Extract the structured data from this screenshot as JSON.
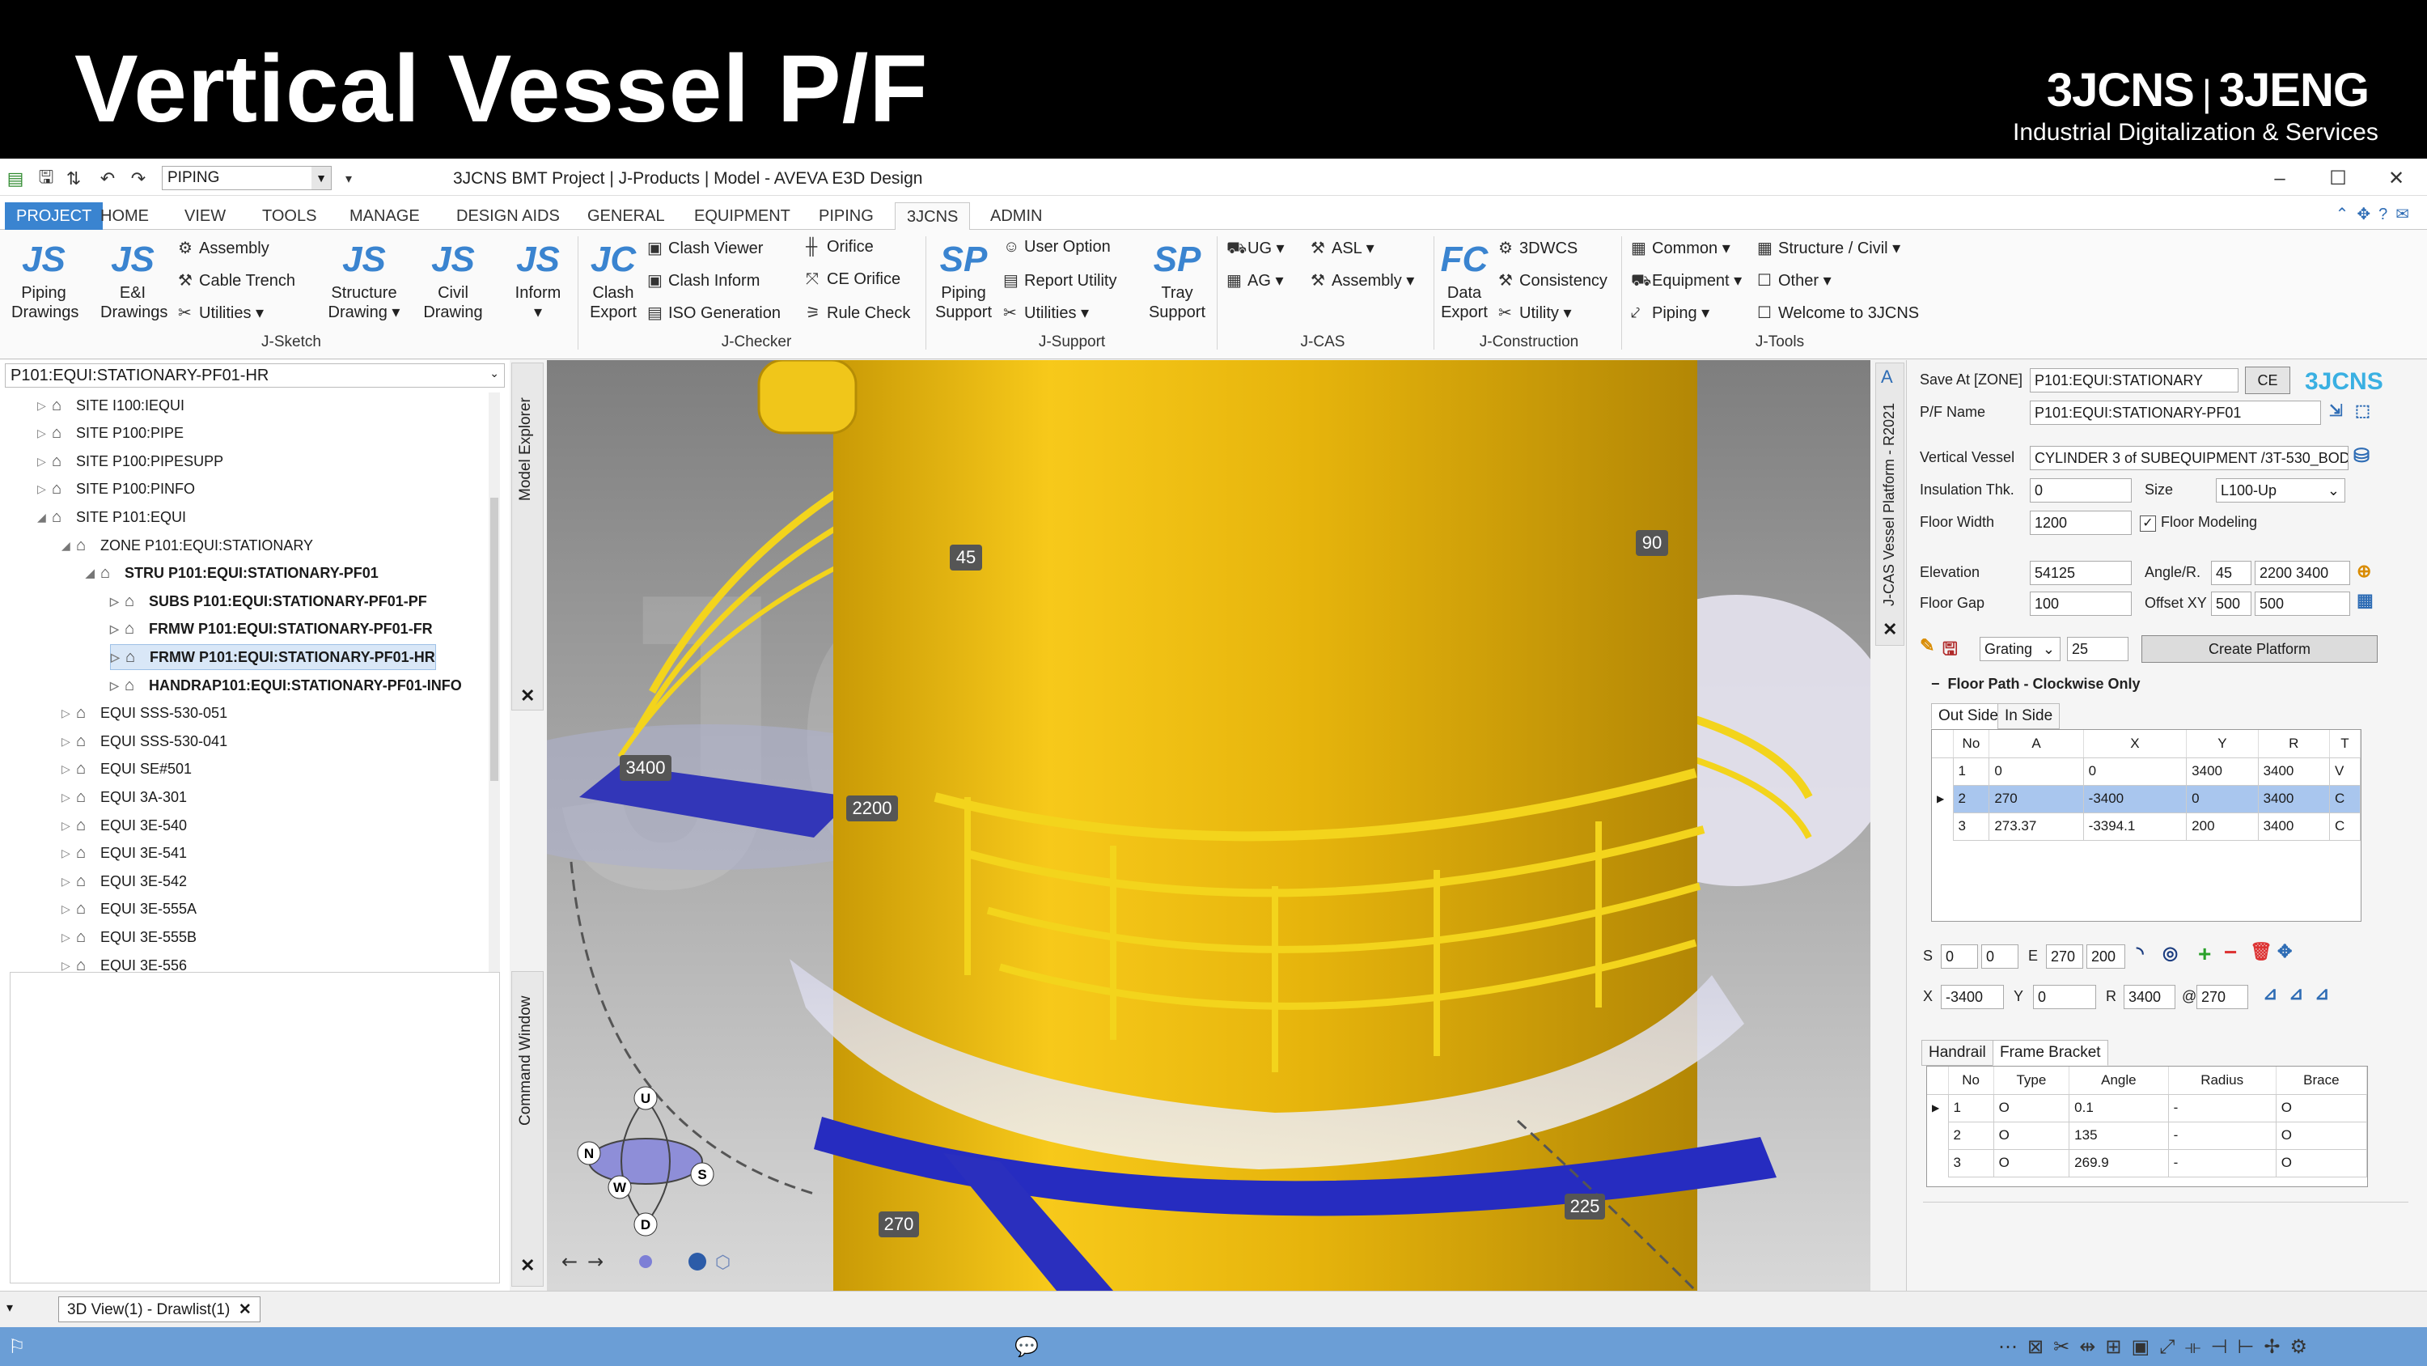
{
  "banner": {
    "title": "Vertical Vessel P/F",
    "brand_left": "3JCNS",
    "brand_right": "3JENG",
    "brand_sub": "Industrial Digitalization & Services"
  },
  "titlebar": {
    "quick_combo": "PIPING",
    "app_title": "3JCNS BMT Project | J-Products | Model - AVEVA E3D Design"
  },
  "tabs": [
    "PROJECT",
    "HOME",
    "VIEW",
    "TOOLS",
    "MANAGE",
    "DESIGN AIDS",
    "GENERAL",
    "EQUIPMENT",
    "PIPING",
    "3JCNS",
    "ADMIN"
  ],
  "ribbon": {
    "piping_drawings": [
      "Piping",
      "Drawings"
    ],
    "ei_drawings": [
      "E&I",
      "Drawings"
    ],
    "assembly": "Assembly",
    "cable_trench": "Cable Trench",
    "utilities": "Utilities",
    "structure_drawing": [
      "Structure",
      "Drawing"
    ],
    "civil_drawing": [
      "Civil",
      "Drawing"
    ],
    "inform": "Inform",
    "group_jsketch": "J-Sketch",
    "clash_export": [
      "Clash",
      "Export"
    ],
    "clash_viewer": "Clash Viewer",
    "clash_inform": "Clash Inform",
    "iso_generation": "ISO Generation",
    "orifice": "Orifice",
    "ce_orifice": "CE Orifice",
    "rule_check": "Rule Check",
    "group_jchecker": "J-Checker",
    "piping_support": [
      "Piping",
      "Support"
    ],
    "user_option": "User Option",
    "report_utility": "Report Utility",
    "utilities2": "Utilities",
    "tray_support": [
      "Tray",
      "Support"
    ],
    "group_jsupport": "J-Support",
    "ug": "UG",
    "ag": "AG",
    "asl": "ASL",
    "assembly2": "Assembly",
    "group_jcas": "J-CAS",
    "data_export": [
      "Data",
      "Export"
    ],
    "dwcs": "3DWCS",
    "consistency": "Consistency",
    "utility": "Utility",
    "group_jconstruction": "J-Construction",
    "common": "Common",
    "equipment": "Equipment",
    "piping": "Piping",
    "structure_civil": "Structure / Civil",
    "other": "Other",
    "welcome": "Welcome to 3JCNS",
    "group_jtools": "J-Tools"
  },
  "explorer": {
    "current_element": "P101:EQUI:STATIONARY-PF01-HR",
    "dock_label": "Model Explorer",
    "nodes": [
      {
        "label": "SITE I100:IEQUI",
        "level": 1,
        "arrow": "▷",
        "bold": false
      },
      {
        "label": "SITE P100:PIPE",
        "level": 1,
        "arrow": "▷",
        "bold": false
      },
      {
        "label": "SITE P100:PIPESUPP",
        "level": 1,
        "arrow": "▷",
        "bold": false
      },
      {
        "label": "SITE P100:PINFO",
        "level": 1,
        "arrow": "▷",
        "bold": false
      },
      {
        "label": "SITE P101:EQUI",
        "level": 1,
        "arrow": "◢",
        "bold": false
      },
      {
        "label": "ZONE P101:EQUI:STATIONARY",
        "level": 2,
        "arrow": "◢",
        "bold": false
      },
      {
        "label": "STRU P101:EQUI:STATIONARY-PF01",
        "level": 3,
        "arrow": "◢",
        "bold": true
      },
      {
        "label": "SUBS P101:EQUI:STATIONARY-PF01-PF",
        "level": 4,
        "arrow": "▷",
        "bold": true
      },
      {
        "label": "FRMW P101:EQUI:STATIONARY-PF01-FR",
        "level": 4,
        "arrow": "▷",
        "bold": true
      },
      {
        "label": "FRMW P101:EQUI:STATIONARY-PF01-HR",
        "level": 4,
        "arrow": "▷",
        "bold": true
      },
      {
        "label": "HANDRAP101:EQUI:STATIONARY-PF01-INFO",
        "level": 4,
        "arrow": "▷",
        "bold": true
      },
      {
        "label": "EQUI SSS-530-051",
        "level": 2,
        "arrow": "▷",
        "bold": false
      },
      {
        "label": "EQUI SSS-530-041",
        "level": 2,
        "arrow": "▷",
        "bold": false
      },
      {
        "label": "EQUI SE#501",
        "level": 2,
        "arrow": "▷",
        "bold": false
      },
      {
        "label": "EQUI 3A-301",
        "level": 2,
        "arrow": "▷",
        "bold": false
      },
      {
        "label": "EQUI 3E-540",
        "level": 2,
        "arrow": "▷",
        "bold": false
      },
      {
        "label": "EQUI 3E-541",
        "level": 2,
        "arrow": "▷",
        "bold": false
      },
      {
        "label": "EQUI 3E-542",
        "level": 2,
        "arrow": "▷",
        "bold": false
      },
      {
        "label": "EQUI 3E-555A",
        "level": 2,
        "arrow": "▷",
        "bold": false
      },
      {
        "label": "EQUI 3E-555B",
        "level": 2,
        "arrow": "▷",
        "bold": false
      },
      {
        "label": "EQUI 3E-556",
        "level": 2,
        "arrow": "▷",
        "bold": false
      }
    ],
    "selected_index": 9,
    "command_dock_label": "Command Window"
  },
  "viewport": {
    "dims": [
      "45",
      "90",
      "3400",
      "2200",
      "270",
      "225"
    ],
    "watermark": "3JCNS",
    "compass": [
      "U",
      "N",
      "W",
      "S",
      "D"
    ]
  },
  "panel": {
    "dock_label": "J-CAS Vessel Platform - R2021",
    "save_at_label": "Save At [ZONE]",
    "save_at_value": "P101:EQUI:STATIONARY",
    "ce_button": "CE",
    "logo": "3JCNS",
    "pf_name_label": "P/F Name",
    "pf_name_value": "P101:EQUI:STATIONARY-PF01",
    "vessel_label": "Vertical Vessel",
    "vessel_value": "CYLINDER 3 of SUBEQUIPMENT /3T-530_BODY",
    "insulation_label": "Insulation Thk.",
    "insulation_value": "0",
    "size_label": "Size",
    "size_value": "L100-Up",
    "floor_width_label": "Floor Width",
    "floor_width_value": "1200",
    "floor_modeling_label": "Floor Modeling",
    "elevation_label": "Elevation",
    "elevation_value": "54125",
    "angle_label": "Angle/R.",
    "angle_value": "45",
    "angle_r_value": "2200 3400",
    "floor_gap_label": "Floor Gap",
    "floor_gap_value": "100",
    "offset_label": "Offset XY",
    "offset_x": "500",
    "offset_y": "500",
    "grating_value": "Grating",
    "grating_num": "25",
    "create_button": "Create Platform",
    "floor_path_label": "Floor Path - Clockwise Only",
    "side_tabs": [
      "Out Side",
      "In Side"
    ],
    "path_headers": [
      "No",
      "A",
      "X",
      "Y",
      "R",
      "T"
    ],
    "path_rows": [
      [
        "1",
        "0",
        "0",
        "3400",
        "3400",
        "V"
      ],
      [
        "2",
        "270",
        "-3400",
        "0",
        "3400",
        "C"
      ],
      [
        "3",
        "273.37",
        "-3394.1",
        "200",
        "3400",
        "C"
      ]
    ],
    "s_label": "S",
    "s1": "0",
    "s2": "0",
    "e_label": "E",
    "e1": "270",
    "e2": "200",
    "x_label": "X",
    "x_value": "-3400",
    "y_label": "Y",
    "y_value": "0",
    "r_label": "R",
    "r_value": "3400",
    "at_label": "@",
    "at_value": "270",
    "lower_tabs": [
      "Handrail",
      "Frame Bracket"
    ],
    "rail_headers": [
      "No",
      "Type",
      "Angle",
      "Radius",
      "Brace"
    ],
    "rail_rows": [
      [
        "1",
        "O",
        "0.1",
        "-",
        "O"
      ],
      [
        "2",
        "O",
        "135",
        "-",
        "O"
      ],
      [
        "3",
        "O",
        "269.9",
        "-",
        "O"
      ]
    ]
  },
  "docbar": {
    "tab_label": "3D View(1) - Drawlist(1)"
  }
}
